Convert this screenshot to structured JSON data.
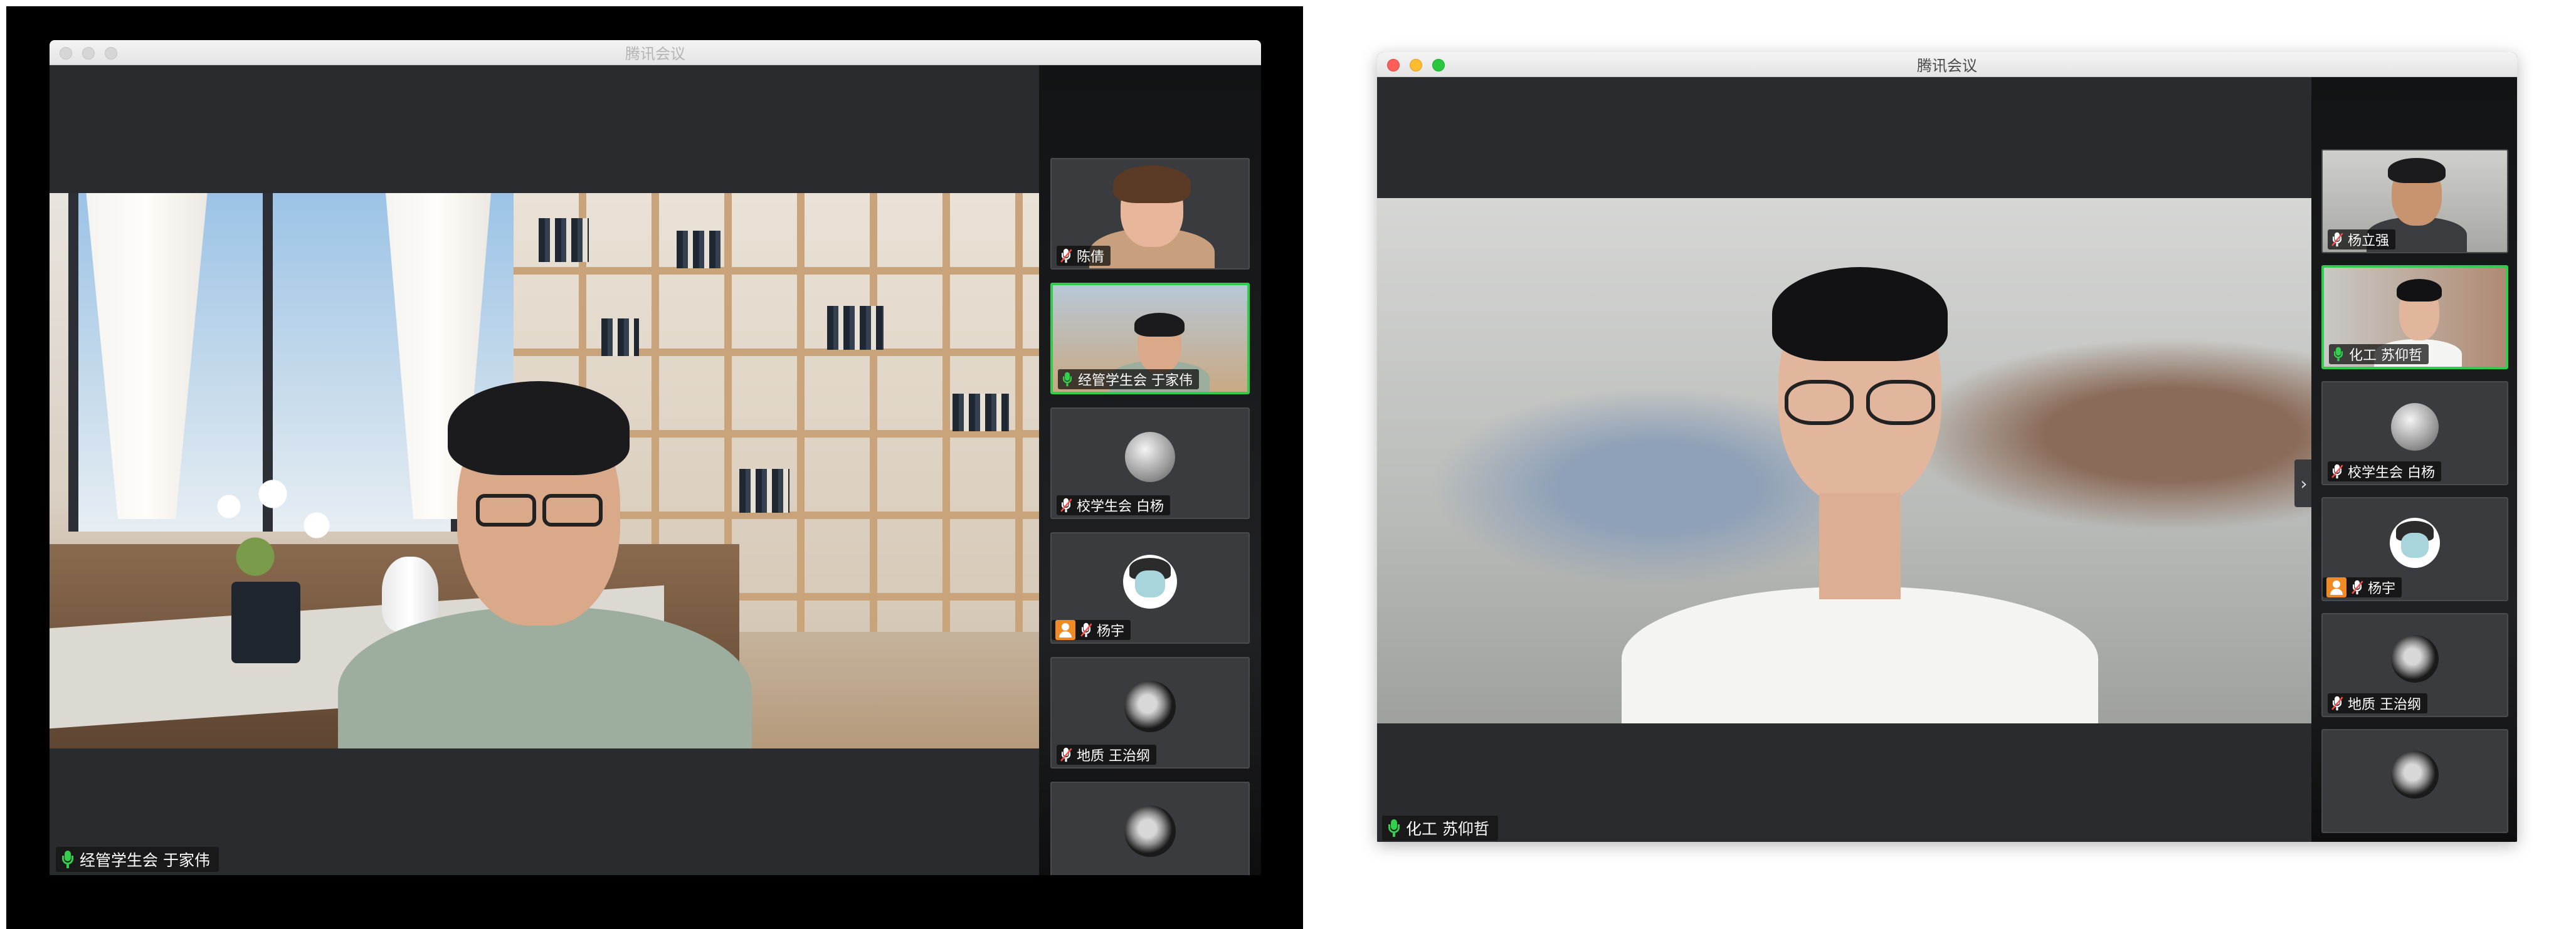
{
  "left_window": {
    "title": "腾讯会议",
    "main_speaker": {
      "name": "经管学生会 于家伟",
      "mic": "on"
    },
    "participants": [
      {
        "name": "陈倩",
        "mic": "off",
        "video": true,
        "active": false
      },
      {
        "name": "经管学生会 于家伟",
        "mic": "on",
        "video": true,
        "active": true
      },
      {
        "name": "校学生会 白杨",
        "mic": "off",
        "avatar": "rock-avatar",
        "active": false
      },
      {
        "name": "杨宇",
        "mic": "off",
        "avatar": "cartoon-avatar",
        "host": true,
        "active": false
      },
      {
        "name": "地质 王治纲",
        "mic": "off",
        "avatar": "moon-avatar",
        "active": false
      }
    ]
  },
  "right_window": {
    "title": "腾讯会议",
    "main_speaker": {
      "name": "化工 苏仰哲",
      "mic": "on"
    },
    "scroll_arrow": "›",
    "participants": [
      {
        "name": "杨立强",
        "mic": "off",
        "video": true,
        "active": false
      },
      {
        "name": "化工 苏仰哲",
        "mic": "on",
        "video": true,
        "active": true
      },
      {
        "name": "校学生会 白杨",
        "mic": "off",
        "avatar": "rock-avatar",
        "active": false
      },
      {
        "name": "杨宇",
        "mic": "off",
        "avatar": "cartoon-avatar",
        "host": true,
        "active": false
      },
      {
        "name": "地质 王治纲",
        "mic": "off",
        "avatar": "moon-avatar",
        "active": false
      }
    ]
  },
  "colors": {
    "speaking_green": "#2fcd4b",
    "host_orange": "#f08a24",
    "muted_red": "#ff4b4b"
  }
}
